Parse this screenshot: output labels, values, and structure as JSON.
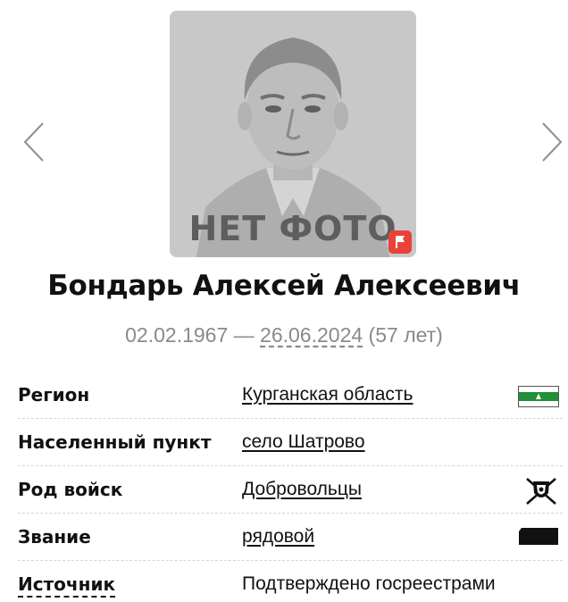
{
  "photo": {
    "placeholder_text": "НЕТ ФОТО",
    "flag_color": "#e8423a"
  },
  "person": {
    "name": "Бондарь Алексей Алексеевич",
    "birth_date": "02.02.1967",
    "separator": " — ",
    "death_date": "26.06.2024",
    "age": " (57 лет)"
  },
  "rows": [
    {
      "label": "Регион",
      "value": "Курганская область",
      "icon": "region-flag-icon"
    },
    {
      "label": "Населенный пункт",
      "value": "село Шатрово"
    },
    {
      "label": "Род войск",
      "value": "Добровольцы",
      "icon": "volunteers-emblem-icon"
    },
    {
      "label": "Звание",
      "value": "рядовой",
      "icon": "rank-insignia-icon"
    },
    {
      "label": "Источник",
      "value": "Подтверждено госреестрами"
    }
  ],
  "colors": {
    "region_flag_green": "#1f8f3a",
    "muted_text": "#8a8a8a"
  }
}
